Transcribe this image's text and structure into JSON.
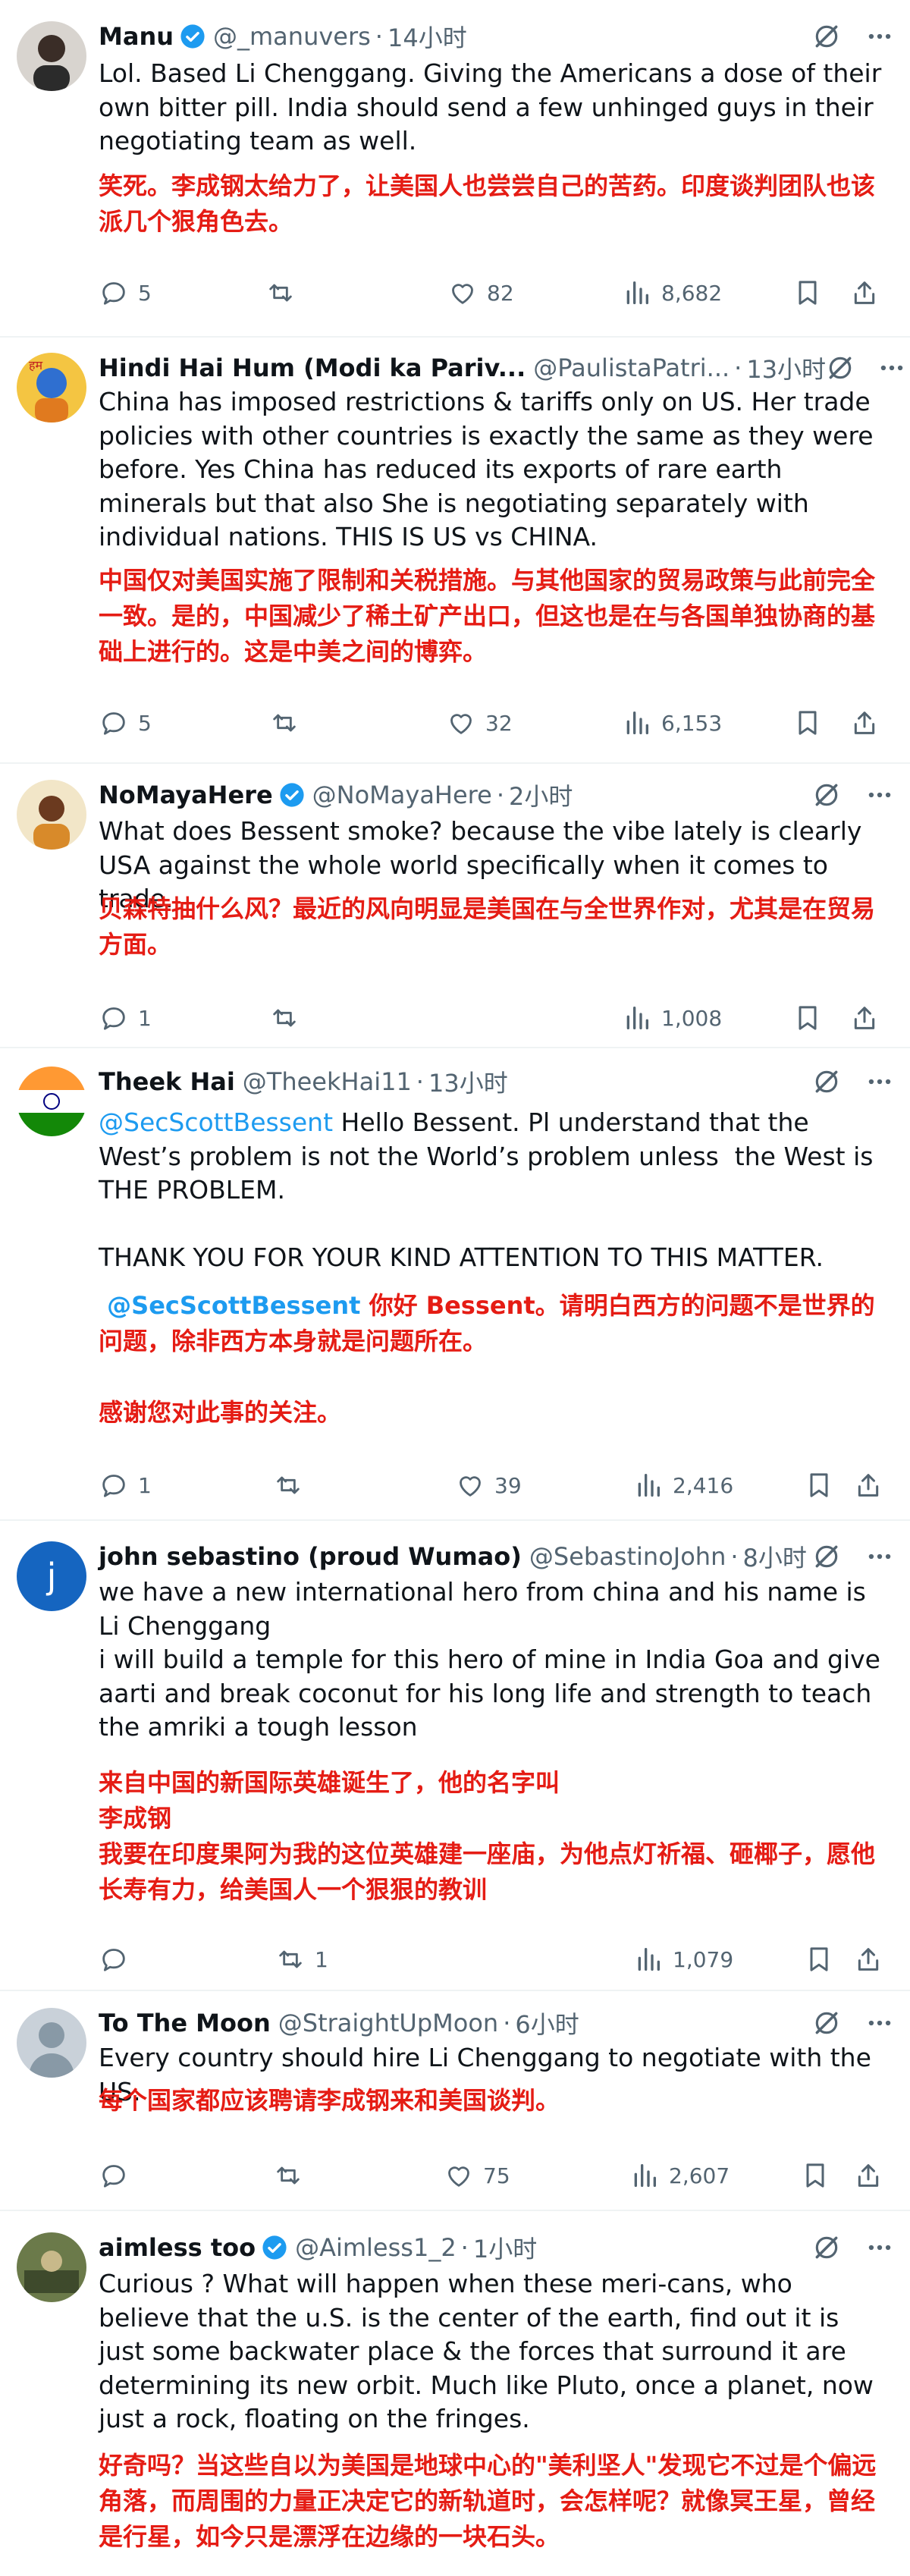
{
  "icons": {
    "verified": "verified-badge-icon",
    "grok": "grok-icon",
    "more": "more-icon",
    "reply": "reply-icon",
    "retweet": "retweet-icon",
    "like": "like-icon",
    "views": "views-icon",
    "bookmark": "bookmark-icon",
    "share": "share-icon"
  },
  "colors": {
    "mention": "#1d9bf0",
    "translation": "#e51c14",
    "muted": "#536471",
    "verified": "#1d9bf0"
  },
  "tweets": [
    {
      "name": "Manu",
      "verified": true,
      "handle": "@_manuvers",
      "time": "14小时",
      "text": "Lol. Based Li Chenggang. Giving the Americans a dose of their own bitter pill. India should send a few unhinged guys in their negotiating team as well.",
      "translation": "笑死。李成钢太给力了，让美国人也尝尝自己的苦药。印度谈判团队也该派几个狠角色去。",
      "replies": "5",
      "retweets": "",
      "likes": "82",
      "views": "8,682"
    },
    {
      "name": "Hindi Hai Hum (Modi ka Pariv...",
      "verified": false,
      "handle": "@PaulistaPatri...",
      "time": "13小时",
      "text": "China has imposed restrictions & tariffs only on US. Her trade policies with other countries is exactly the same as they were before. Yes China has reduced its exports of rare earth minerals but that also She is negotiating separately with individual nations. THIS IS US vs CHINA.",
      "translation": "中国仅对美国实施了限制和关税措施。与其他国家的贸易政策与此前完全一致。是的，中国减少了稀土矿产出口，但这也是在与各国单独协商的基础上进行的。这是中美之间的博弈。",
      "replies": "5",
      "retweets": "",
      "likes": "32",
      "views": "6,153"
    },
    {
      "name": "NoMayaHere",
      "verified": true,
      "handle": "@NoMayaHere",
      "time": "2小时",
      "text": "What does Bessent smoke? because the vibe lately is clearly USA against the whole world specifically when it comes to trade.",
      "translation": "贝森特抽什么风？最近的风向明显是美国在与全世界作对，尤其是在贸易方面。",
      "replies": "1",
      "retweets": "",
      "likes": "",
      "views": "1,008"
    },
    {
      "name": "Theek Hai",
      "verified": false,
      "handle": "@TheekHai11",
      "time": "13小时",
      "mention": "@SecScottBessent",
      "text_after_mention": " Hello Bessent. Pl understand that the West’s problem is not the World’s problem unless  the West is THE PROBLEM.\n\nTHANK YOU FOR YOUR KIND ATTENTION TO THIS MATTER.",
      "translation_mention": " @SecScottBessent",
      "translation_after_mention": " 你好 Bessent。请明白西方的问题不是世界的问题，除非西方本身就是问题所在。\n\n感谢您对此事的关注。",
      "replies": "1",
      "retweets": "",
      "likes": "39",
      "views": "2,416"
    },
    {
      "name": "john sebastino (proud Wumao)",
      "verified": false,
      "handle": "@SebastinoJohn",
      "time": "8小时",
      "text": "we have a new international hero from china and his name is\nLi Chenggang\ni will build a temple for this hero of mine in India Goa and give aarti and break coconut for his long life and strength to teach the amriki a tough lesson",
      "translation": "来自中国的新国际英雄诞生了，他的名字叫\n李成钢\n我要在印度果阿为我的这位英雄建一座庙，为他点灯祈福、砸椰子，愿他长寿有力，给美国人一个狠狠的教训",
      "replies": "",
      "retweets": "1",
      "likes": "",
      "views": "1,079"
    },
    {
      "name": "To The Moon",
      "verified": false,
      "handle": "@StraightUpMoon",
      "time": "6小时",
      "text": "Every country should hire Li Chenggang to negotiate with the US.",
      "translation": "每个国家都应该聘请李成钢来和美国谈判。",
      "replies": "",
      "retweets": "",
      "likes": "75",
      "views": "2,607"
    },
    {
      "name": "aimless too",
      "verified": true,
      "handle": "@Aimless1_2",
      "time": "1小时",
      "text": "Curious ? What will happen when these meri-cans, who believe that the u.S. is the center of the earth, find out it is just some backwater place & the forces that surround it are determining its new orbit. Much like Pluto, once a planet, now just a rock, floating on the fringes.",
      "translation": "好奇吗？当这些自以为美国是地球中心的\"美利坚人\"发现它不过是个偏远角落，而周围的力量正决定它的新轨道时，会怎样呢？就像冥王星，曾经是行星，如今只是漂浮在边缘的一块石头。",
      "replies": "",
      "retweets": "",
      "likes": "",
      "views": ""
    }
  ]
}
